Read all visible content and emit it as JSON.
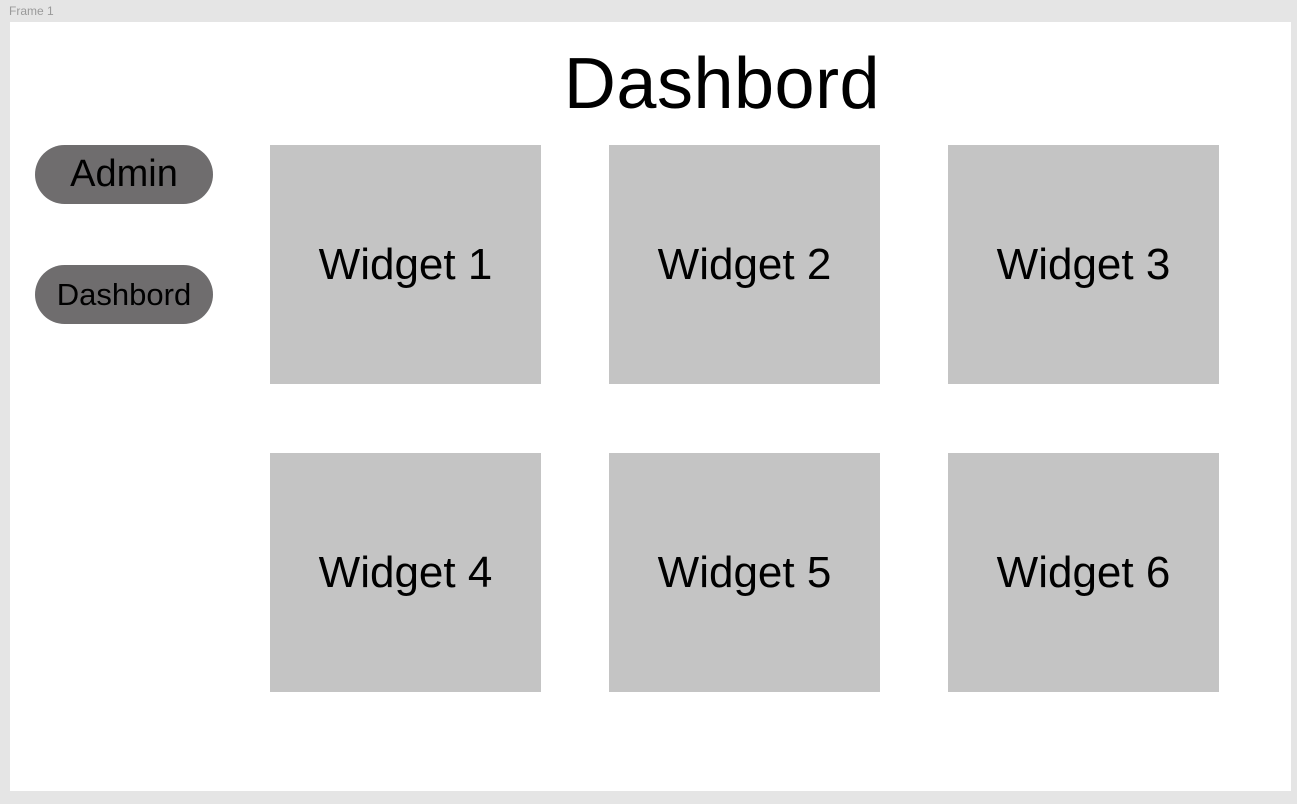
{
  "frame": {
    "label": "Frame 1"
  },
  "header": {
    "title": "Dashbord"
  },
  "sidebar": {
    "items": [
      {
        "label": "Admin"
      },
      {
        "label": "Dashbord"
      }
    ]
  },
  "widgets": [
    {
      "label": "Widget 1"
    },
    {
      "label": "Widget 2"
    },
    {
      "label": "Widget 3"
    },
    {
      "label": "Widget 4"
    },
    {
      "label": "Widget 5"
    },
    {
      "label": "Widget 6"
    }
  ],
  "colors": {
    "canvas": "#e5e5e5",
    "frame": "#ffffff",
    "nav_pill": "#6f6d6e",
    "widget": "#c4c4c4"
  }
}
